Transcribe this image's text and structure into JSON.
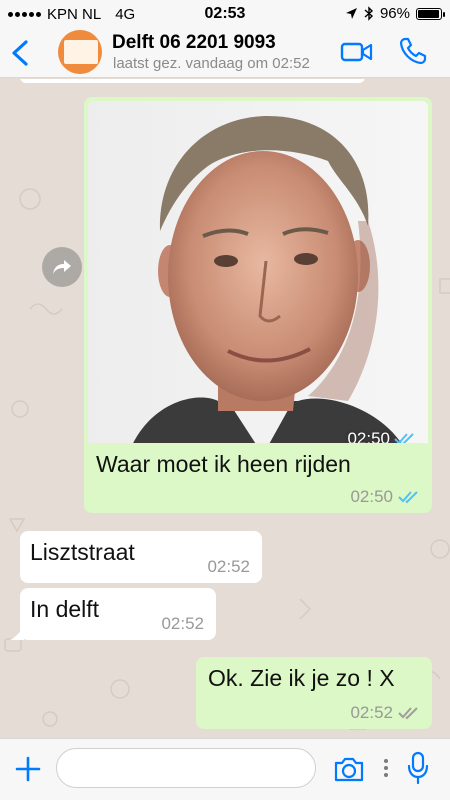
{
  "status_bar": {
    "carrier": "KPN NL",
    "network": "4G",
    "time": "02:53",
    "battery": "96%",
    "battery_level": 0.96
  },
  "header": {
    "contact_name": "Delft 06 2201 9093",
    "last_seen": "laatst gez. vandaag om 02:52",
    "back_icon": "chevron-left-icon",
    "video_icon": "video-camera-icon",
    "call_icon": "phone-icon"
  },
  "messages": [
    {
      "type": "image",
      "direction": "outgoing",
      "time": "02:50",
      "status": "read"
    },
    {
      "type": "text",
      "direction": "outgoing",
      "text": "Waar moet ik heen rijden",
      "time": "02:50",
      "status": "read"
    },
    {
      "type": "text",
      "direction": "incoming",
      "text": "Lisztstraat",
      "time": "02:52"
    },
    {
      "type": "text",
      "direction": "incoming",
      "text": "In delft",
      "time": "02:52"
    },
    {
      "type": "text",
      "direction": "outgoing",
      "text": "Ok. Zie ik je zo ! X",
      "time": "02:52",
      "status": "delivered"
    }
  ],
  "input": {
    "value": "",
    "placeholder": ""
  },
  "colors": {
    "accent": "#007aff",
    "outgoing_bubble": "#dcf8c6",
    "incoming_bubble": "#ffffff",
    "chat_bg": "#e5ddd5",
    "read_ticks": "#4fc3f7"
  }
}
